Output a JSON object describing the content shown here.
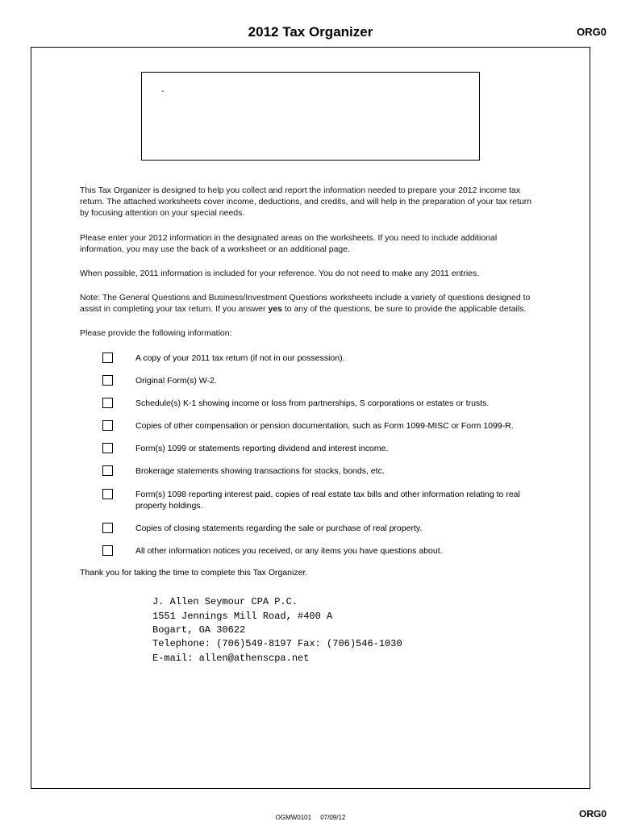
{
  "header": {
    "title": "2012 Tax Organizer",
    "code": "ORG0"
  },
  "inner_box": {
    "mark": "-"
  },
  "paragraphs": {
    "p1": "This Tax Organizer is designed to help you collect and report the information needed to prepare your 2012 income tax return. The attached worksheets cover income, deductions, and credits, and will help in the preparation of your tax return by focusing attention on your special needs.",
    "p2": "Please enter your 2012 information in the designated areas on the worksheets. If you need to include additional information, you may use the back of a worksheet or an additional page.",
    "p3": "When possible, 2011 information is included for your reference. You do not need to make any 2011 entries.",
    "p4_prefix": "Note: The General Questions and Business/Investment Questions worksheets include a variety of questions designed to assist in completing your tax return. If you answer ",
    "p4_bold": "yes",
    "p4_suffix": " to any of the questions, be sure to provide the applicable details.",
    "p5": "Please provide the following information:"
  },
  "checklist": [
    "A copy of your 2011 tax return (if not in our possession).",
    "Original Form(s) W-2.",
    "Schedule(s) K-1 showing income or loss from partnerships, S corporations or estates or trusts.",
    "Copies of other compensation or pension documentation, such as Form 1099-MISC or Form 1099-R.",
    "Form(s) 1099 or statements reporting dividend and interest income.",
    "Brokerage statements showing transactions for stocks, bonds, etc.",
    "Form(s) 1098 reporting interest paid, copies of real estate tax bills and other information relating to real property holdings.",
    "Copies of closing statements regarding the sale or purchase of real property.",
    "All other information notices you received, or any items you have questions about."
  ],
  "thankyou": "Thank you for taking the time to complete this Tax Organizer.",
  "contact": {
    "name": "J. Allen Seymour CPA P.C.",
    "address1": "1551 Jennings Mill Road, #400 A",
    "address2": "Bogart, GA 30622",
    "phone": "Telephone: (706)549-8197  Fax: (706)546-1030",
    "email": "E-mail: allen@athenscpa.net"
  },
  "footer": {
    "left": "OGMW0101",
    "date": "07/09/12",
    "code": "ORG0"
  }
}
